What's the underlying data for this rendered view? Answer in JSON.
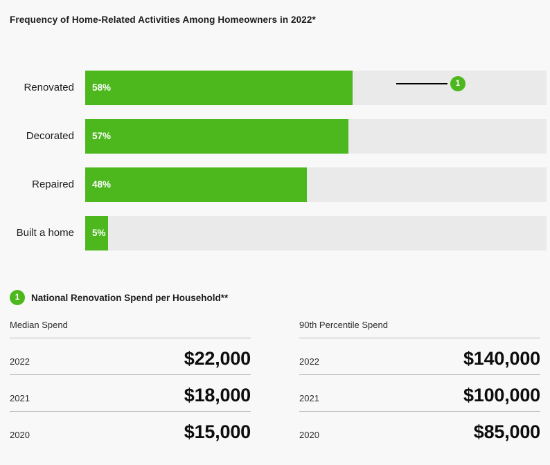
{
  "chart_title": "Frequency of Home-Related Activities Among Homeowners in 2022*",
  "colors": {
    "accent_green": "#4cb81e",
    "track_gray": "#eaeaea",
    "page_background": "#f8f8f8",
    "text_dark": "#1d1d1d",
    "rule_gray": "#b9b9b9"
  },
  "chart_data": {
    "type": "bar",
    "orientation": "horizontal",
    "title": "Frequency of Home-Related Activities Among Homeowners in 2022*",
    "xlabel": "",
    "ylabel": "",
    "xlim": [
      0,
      100
    ],
    "grid": false,
    "legend": "none",
    "value_suffix": "%",
    "categories": [
      "Renovated",
      "Decorated",
      "Repaired",
      "Built a home"
    ],
    "values": [
      58,
      57,
      48,
      5
    ],
    "value_labels": [
      "58%",
      "57%",
      "48%",
      "5%"
    ],
    "annotations": [
      {
        "marker": "1",
        "attached_to": "Renovated",
        "text": "National Renovation Spend per Household**"
      }
    ]
  },
  "bars": [
    {
      "label": "Renovated",
      "value": 58,
      "value_label": "58%",
      "has_callout": true
    },
    {
      "label": "Decorated",
      "value": 57,
      "value_label": "57%",
      "has_callout": false
    },
    {
      "label": "Repaired",
      "value": 48,
      "value_label": "48%",
      "has_callout": false
    },
    {
      "label": "Built a home",
      "value": 5,
      "value_label": "5%",
      "has_callout": false
    }
  ],
  "callout": {
    "badge_number": "1"
  },
  "note": {
    "badge_number": "1",
    "heading": "National Renovation Spend per Household**"
  },
  "tables": [
    {
      "header": "Median Spend",
      "rows": [
        {
          "year": "2022",
          "amount": "$22,000"
        },
        {
          "year": "2021",
          "amount": "$18,000"
        },
        {
          "year": "2020",
          "amount": "$15,000"
        }
      ]
    },
    {
      "header": "90th Percentile Spend",
      "rows": [
        {
          "year": "2022",
          "amount": "$140,000"
        },
        {
          "year": "2021",
          "amount": "$100,000"
        },
        {
          "year": "2020",
          "amount": "$85,000"
        }
      ]
    }
  ]
}
